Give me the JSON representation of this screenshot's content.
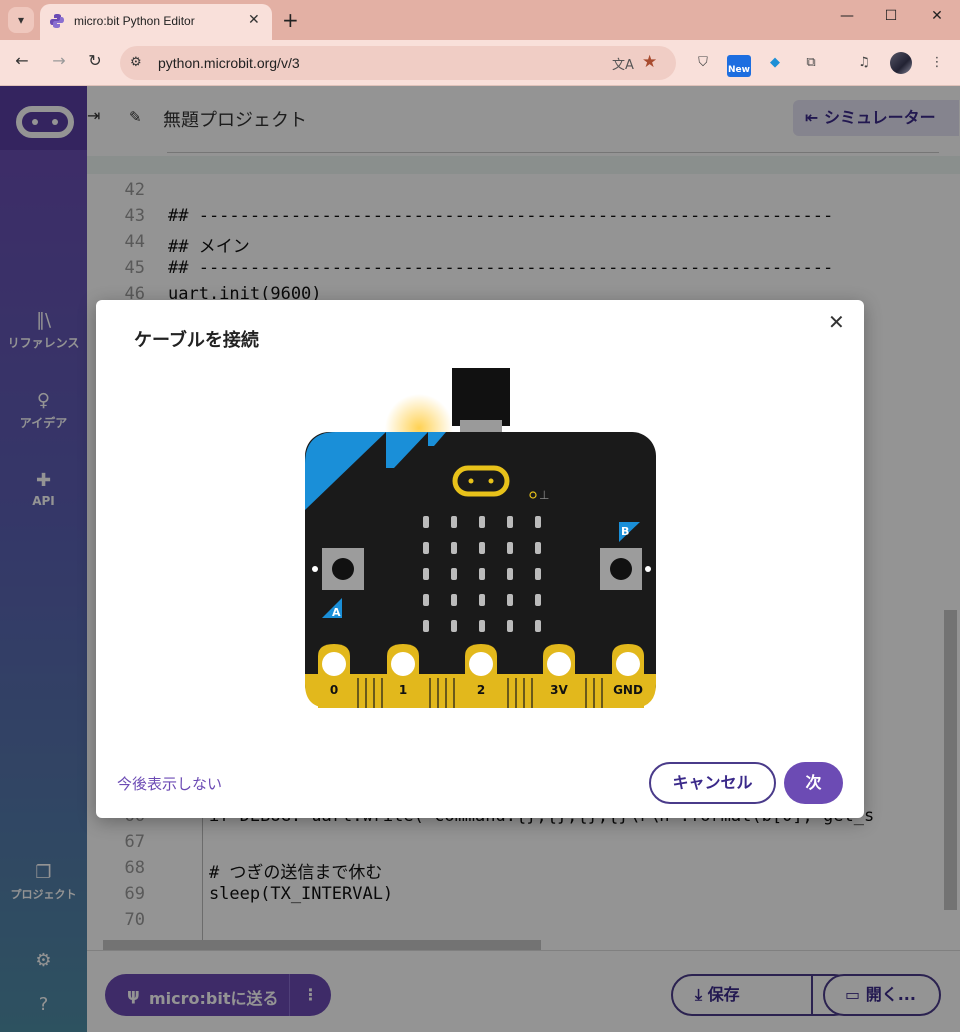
{
  "browser": {
    "tab_title": "micro:bit Python Editor",
    "url": "python.microbit.org/v/3",
    "new_badge": "New"
  },
  "sidebar": {
    "items": [
      {
        "label": "リファレンス"
      },
      {
        "label": "アイデア"
      },
      {
        "label": "API"
      },
      {
        "label": "プロジェクト"
      }
    ]
  },
  "header": {
    "project_name": "無題プロジェクト",
    "simulator_label": "シミュレーター"
  },
  "editor": {
    "lines": [
      {
        "n": "42",
        "t": ""
      },
      {
        "n": "43",
        "t": "## --------------------------------------------------------------"
      },
      {
        "n": "44",
        "t": "## メイン"
      },
      {
        "n": "45",
        "t": "## --------------------------------------------------------------"
      },
      {
        "n": "46",
        "t": "uart.init(9600)"
      },
      {
        "n": "66",
        "t": "    if DEBUG: uart.write(\"command:{},{},{},{}\\r\\n\".format(b[0], get_s"
      },
      {
        "n": "67",
        "t": ""
      },
      {
        "n": "68",
        "t": "    # つぎの送信まで休む"
      },
      {
        "n": "69",
        "t": "    sleep(TX_INTERVAL)"
      },
      {
        "n": "70",
        "t": ""
      }
    ]
  },
  "footer": {
    "send_label": "micro:bitに送る",
    "save_label": "保存",
    "open_label": "開く..."
  },
  "modal": {
    "title": "ケーブルを接続",
    "dont_show": "今後表示しない",
    "cancel": "キャンセル",
    "next": "次",
    "board": {
      "button_a": "A",
      "button_b": "B",
      "pins": [
        "0",
        "1",
        "2",
        "3V",
        "GND"
      ]
    }
  }
}
